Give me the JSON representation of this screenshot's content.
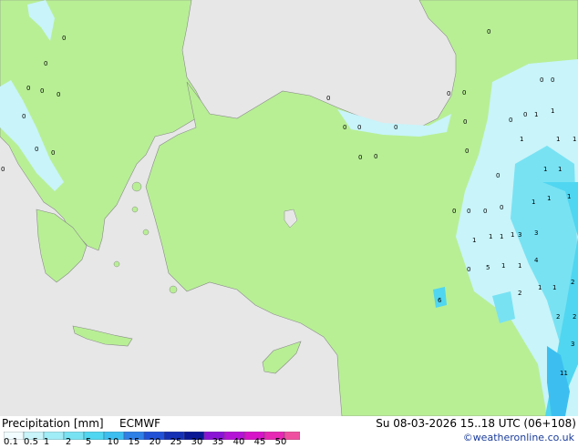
{
  "map": {
    "precip_labels": [
      "0",
      "0",
      "0",
      "0",
      "0",
      "0",
      "0",
      "0",
      "0",
      "0",
      "0",
      "0",
      "0",
      "0",
      "0",
      "0",
      "0",
      "0",
      "0",
      "0",
      "0",
      "0",
      "0",
      "0",
      "0",
      "0",
      "0",
      "0",
      "0",
      "0",
      "1",
      "1",
      "1",
      "1",
      "1",
      "1",
      "1",
      "1",
      "1",
      "1",
      "1",
      "1",
      "1",
      "1",
      "1",
      "1",
      "1",
      "1",
      "2",
      "2",
      "2",
      "2",
      "3",
      "3",
      "3",
      "4",
      "5",
      "6",
      "11"
    ]
  },
  "footer": {
    "title": "Precipitation [mm]",
    "model": "ECMWF",
    "timestamp": "Su 08-03-2026 15..18 UTC (06+108)",
    "credit": "©weatheronline.co.uk"
  },
  "legend": {
    "ticks": [
      "0.1",
      "0.5",
      "1",
      "2",
      "5",
      "10",
      "15",
      "20",
      "25",
      "30",
      "35",
      "40",
      "45",
      "50"
    ],
    "colors": [
      "#f0fcff",
      "#c8f4fa",
      "#a0ecf7",
      "#78e2f3",
      "#50d6f0",
      "#3cbff0",
      "#2e7fe6",
      "#2050d6",
      "#1430b4",
      "#0a1896",
      "#8a14d6",
      "#b414d6",
      "#d614c8",
      "#e628b4",
      "#f050a0"
    ],
    "land_color": "#b8ef95",
    "sea_color": "#e7e7e7",
    "coast_color": "#8a8a8a"
  }
}
